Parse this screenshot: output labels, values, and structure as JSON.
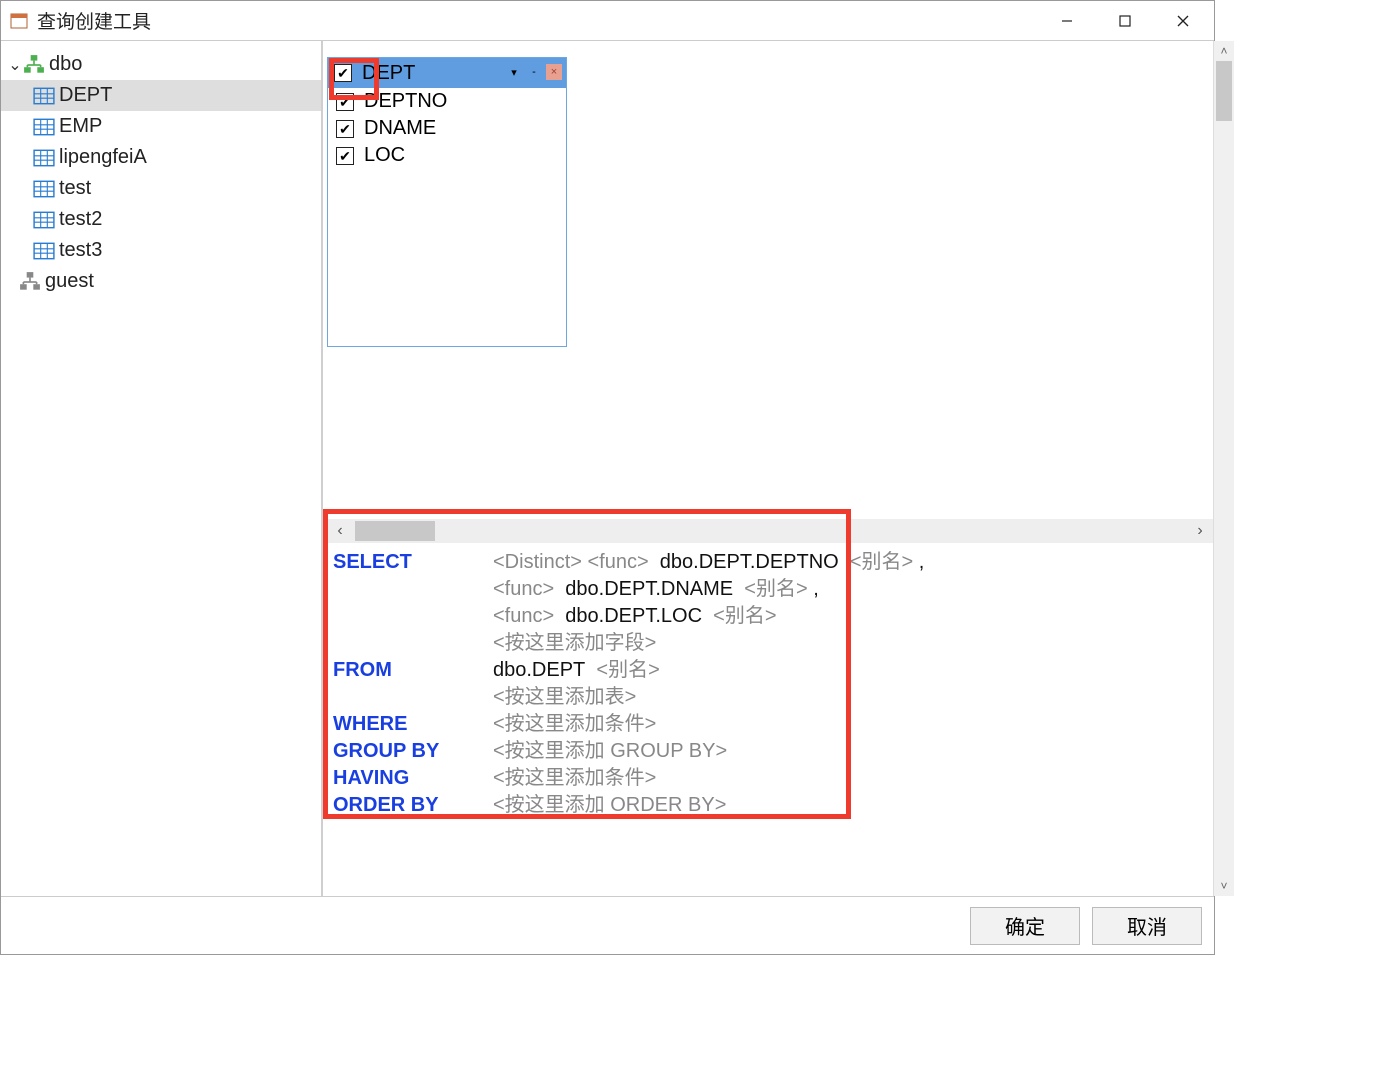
{
  "window": {
    "title": "查询创建工具"
  },
  "tree": {
    "schema": "dbo",
    "tables": [
      "DEPT",
      "EMP",
      "lipengfeiA",
      "test",
      "test2",
      "test3"
    ],
    "selected": "DEPT",
    "other_schema": "guest"
  },
  "table_box": {
    "name": "DEPT",
    "columns": [
      "DEPTNO",
      "DNAME",
      "LOC"
    ]
  },
  "sql": {
    "select_kw": "SELECT",
    "distinct_ph": "<Distinct>",
    "func_ph": "<func>",
    "alias_ph": "<别名>",
    "add_field_ph": "<按这里添加字段>",
    "fields": [
      "dbo.DEPT.DEPTNO",
      "dbo.DEPT.DNAME",
      "dbo.DEPT.LOC"
    ],
    "from_kw": "FROM",
    "from_val": "dbo.DEPT",
    "add_table_ph": "<按这里添加表>",
    "where_kw": "WHERE",
    "add_cond_ph": "<按这里添加条件>",
    "groupby_kw": "GROUP BY",
    "add_groupby_ph": "<按这里添加 GROUP BY>",
    "having_kw": "HAVING",
    "orderby_kw": "ORDER BY",
    "add_orderby_ph": "<按这里添加 ORDER BY>"
  },
  "footer": {
    "ok": "确定",
    "cancel": "取消"
  }
}
